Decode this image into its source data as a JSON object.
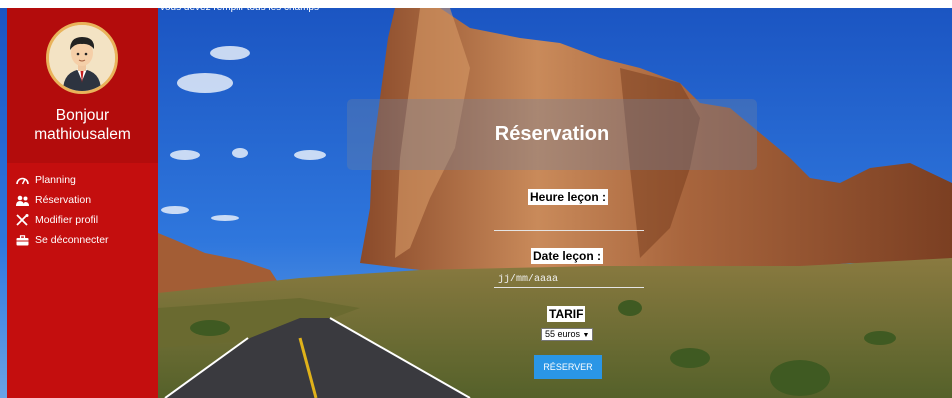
{
  "warning": "vous devez remplir tous les champs",
  "sidebar": {
    "greeting_line1": "Bonjour",
    "greeting_line2": "mathiousalem",
    "items": [
      {
        "label": "Planning",
        "icon": "speedometer-icon"
      },
      {
        "label": "Réservation",
        "icon": "users-icon"
      },
      {
        "label": "Modifier profil",
        "icon": "tools-icon"
      },
      {
        "label": "Se déconnecter",
        "icon": "briefcase-icon"
      }
    ]
  },
  "form": {
    "title": "Réservation",
    "heure_label": "Heure leçon :",
    "heure_value": "",
    "date_label": "Date leçon :",
    "date_placeholder": "jj/mm/aaaa",
    "tarif_label": "TARIF",
    "tarif_selected": "55 euros",
    "submit_label": "RÉSERVER"
  },
  "colors": {
    "sidebar": "#c40e0e",
    "button": "#2a96e6",
    "sky": "#1f5fc7"
  }
}
